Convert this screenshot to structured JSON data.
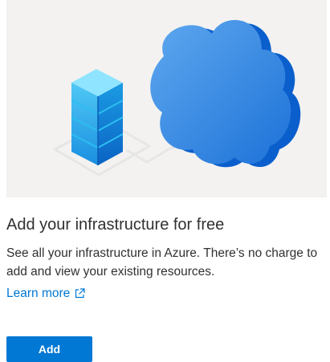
{
  "card": {
    "title": "Add your infrastructure for free",
    "description": "See all your infrastructure in Azure. There’s no charge to add and view your existing resources.",
    "learn_more_label": "Learn more",
    "add_label": "Add",
    "hero_icons": [
      "server-icon",
      "cloud-icon",
      "connector-arrow-icon"
    ]
  },
  "colors": {
    "accent": "#0078d4",
    "hero_background": "#f3f2f1",
    "text": "#323130"
  }
}
